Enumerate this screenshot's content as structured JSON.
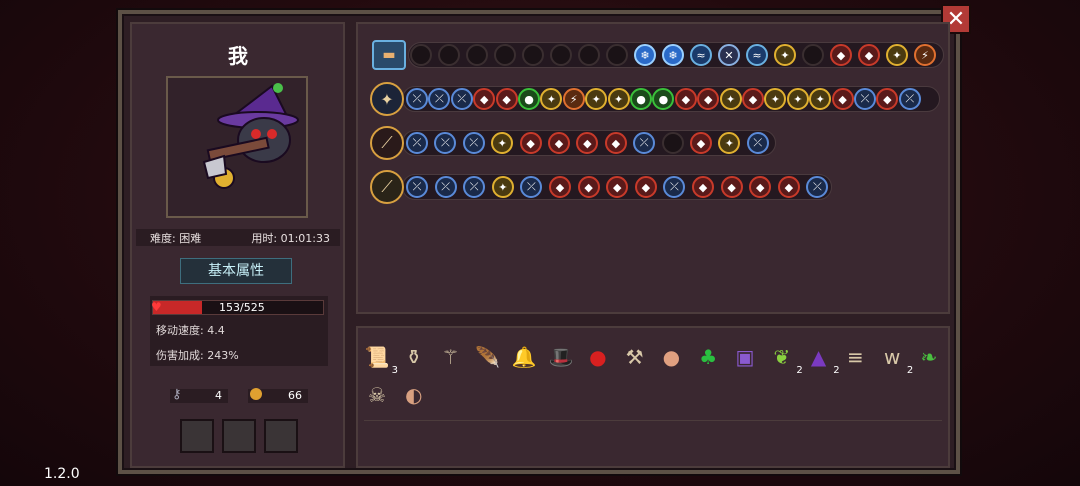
{
  "version": "1.2.0",
  "player": {
    "name": "我",
    "difficulty": "难度: 困难",
    "time": "用时: 01:01:33",
    "attr_button": "基本属性",
    "hp_text": "153/525",
    "hp_fraction": 0.29,
    "move_speed": "移动速度: 4.4",
    "damage_bonus": "伤害加成: 243%",
    "keys": "4",
    "coins": "66"
  },
  "close_label": "✕",
  "rows": [
    {
      "main": "treasure-chest-icon",
      "gems": [
        "empty",
        "empty",
        "empty",
        "empty",
        "empty",
        "empty",
        "empty",
        "empty",
        "ice",
        "ice",
        "wave",
        "sword",
        "wave",
        "gold",
        "empty",
        "red",
        "red",
        "gold",
        "fire"
      ]
    },
    {
      "main": "staff-icon",
      "gems": [
        "blue",
        "blue",
        "blue",
        "red",
        "red",
        "green",
        "gold",
        "fire",
        "gold",
        "gold",
        "green",
        "green",
        "red",
        "red",
        "gold",
        "red",
        "gold",
        "gold",
        "gold",
        "red",
        "blue",
        "red",
        "blue"
      ]
    },
    {
      "main": "staff-icon",
      "gems": [
        "blue",
        "blue",
        "blue",
        "gold",
        "red",
        "red",
        "red",
        "red",
        "blue",
        "empty",
        "red",
        "gold",
        "blue"
      ]
    },
    {
      "main": "staff-icon",
      "gems": [
        "blue",
        "blue",
        "blue",
        "gold",
        "blue",
        "red",
        "red",
        "red",
        "red",
        "blue",
        "red",
        "red",
        "red",
        "red",
        "blue"
      ]
    }
  ],
  "items": [
    {
      "icon": "tome-icon",
      "count": "3"
    },
    {
      "icon": "bottle-icon",
      "count": ""
    },
    {
      "icon": "key-wand-icon",
      "count": ""
    },
    {
      "icon": "feather-icon",
      "count": ""
    },
    {
      "icon": "bell-icon",
      "count": ""
    },
    {
      "icon": "hat-icon",
      "count": ""
    },
    {
      "icon": "eye-icon",
      "count": ""
    },
    {
      "icon": "pickaxe-icon",
      "count": ""
    },
    {
      "icon": "meat-icon",
      "count": ""
    },
    {
      "icon": "clover-icon",
      "count": ""
    },
    {
      "icon": "rune-icon",
      "count": ""
    },
    {
      "icon": "leaf-icon",
      "count": "2"
    },
    {
      "icon": "witch-hat-icon",
      "count": "2"
    },
    {
      "icon": "ribcage-icon",
      "count": ""
    },
    {
      "icon": "teeth-icon",
      "count": "2"
    },
    {
      "icon": "sprout-icon",
      "count": ""
    },
    {
      "icon": "skull-bag-icon",
      "count": ""
    },
    {
      "icon": "shell-icon",
      "count": ""
    }
  ],
  "colors": {
    "hp": "#c82828",
    "gold": "#e0b030",
    "ice": "#3a8ad8",
    "red": "#c83a2a",
    "green": "#2a9a3a"
  }
}
